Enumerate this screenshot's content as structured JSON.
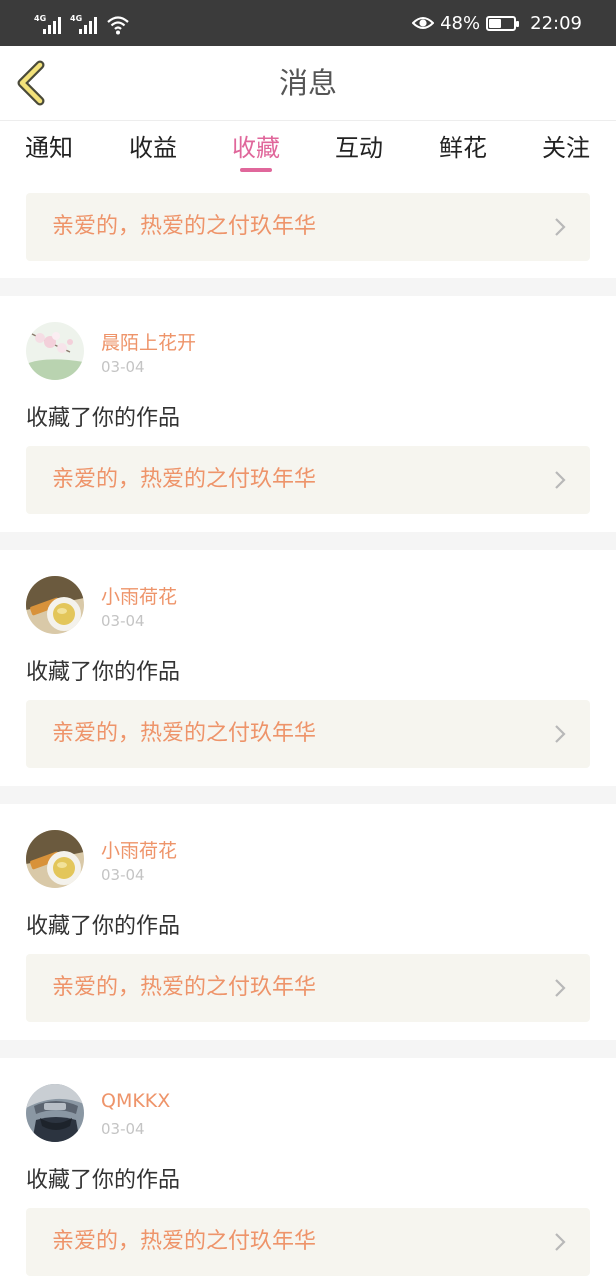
{
  "status_bar": {
    "network_1": "4G",
    "network_2": "4G",
    "battery_percent": "48%",
    "battery_level": 0.48,
    "time": "22:09"
  },
  "header": {
    "title": "消息"
  },
  "tabs": [
    {
      "label": "通知",
      "active": false
    },
    {
      "label": "收益",
      "active": false
    },
    {
      "label": "收藏",
      "active": true
    },
    {
      "label": "互动",
      "active": false
    },
    {
      "label": "鲜花",
      "active": false
    },
    {
      "label": "关注",
      "active": false
    }
  ],
  "colors": {
    "accent": "#e0679b",
    "link": "#ee946a",
    "card_bg": "#f6f5ef"
  },
  "top_work": {
    "title": "亲爱的，热爱的之付玖年华"
  },
  "messages": [
    {
      "user": "晨陌上花开",
      "date": "03-04",
      "action": "收藏了你的作品",
      "work_title": "亲爱的，热爱的之付玖年华",
      "avatar": "blossom-avatar"
    },
    {
      "user": "小雨荷花",
      "date": "03-04",
      "action": "收藏了你的作品",
      "work_title": "亲爱的，热爱的之付玖年华",
      "avatar": "tea-avatar"
    },
    {
      "user": "小雨荷花",
      "date": "03-04",
      "action": "收藏了你的作品",
      "work_title": "亲爱的，热爱的之付玖年华",
      "avatar": "tea-avatar"
    },
    {
      "user": "QMKKX",
      "date": "03-04",
      "action": "收藏了你的作品",
      "work_title": "亲爱的，热爱的之付玖年华",
      "avatar": "anime-avatar"
    }
  ]
}
